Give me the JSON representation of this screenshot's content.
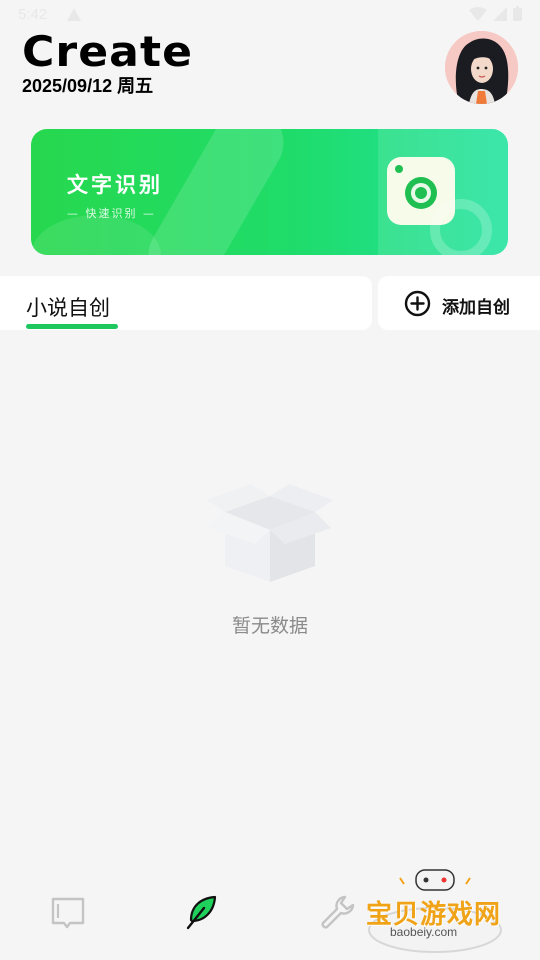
{
  "status_bar": {
    "time": "5:42"
  },
  "header": {
    "title": "Create",
    "date": "2025/09/12 周五"
  },
  "banner": {
    "title": "文字识别",
    "subtitle": "— 快速识别 —"
  },
  "tabs": [
    {
      "label": "小说自创",
      "active": true
    }
  ],
  "add_button": {
    "label": "添加自创"
  },
  "empty_state": {
    "message": "暂无数据"
  },
  "bottom_nav": [
    {
      "icon": "book-icon",
      "active": false
    },
    {
      "icon": "feather-pen-icon",
      "active": true
    },
    {
      "icon": "wrench-icon",
      "active": false
    }
  ],
  "watermark": {
    "text": "宝贝游戏网",
    "url": "baobeiy.com"
  },
  "colors": {
    "accent": "#1ec85f",
    "banner_start": "#27d84e",
    "banner_end": "#22e3a0",
    "background": "#f5f5f5"
  }
}
